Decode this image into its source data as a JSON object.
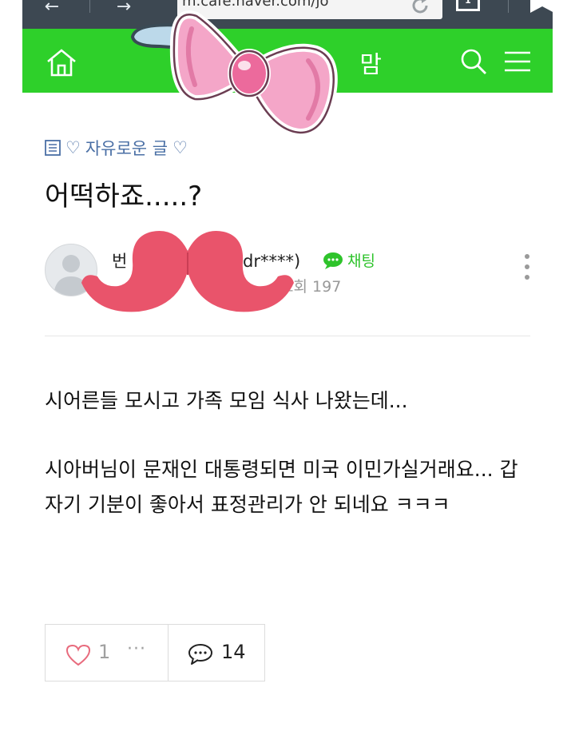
{
  "browser": {
    "url": "m.cafe.naver.com/jo",
    "tab_count": "1"
  },
  "header": {
    "title_visible": "맘"
  },
  "post": {
    "board": "자유로운 글",
    "board_heart_left": "♡",
    "board_heart_right": "♡",
    "title": "어떡하죠.....?",
    "author_visible": "번",
    "author_id_visible": "ndr****)",
    "chat_label": "채팅",
    "views_label": "조회 197",
    "body": [
      "시어른들 모시고 가족 모임 식사 나왔는데...",
      "시아버님이 문재인 대통령되면 미국 이민가실거래요... 갑자기 기분이 좋아서 표정관리가 안 되네요 ㅋㅋㅋ"
    ]
  },
  "actions": {
    "like_count": "1",
    "like_more": "···",
    "comment_count": "14"
  },
  "colors": {
    "header_green": "#2ed02a",
    "browser_bar": "#3d4852",
    "board_blue": "#4a6fa5",
    "chat_green": "#2ec32b",
    "sticker_pink": "#f4a6c8",
    "mustache_red": "#e9546b"
  },
  "icons": [
    "back-arrow-icon",
    "forward-arrow-icon",
    "reload-icon",
    "tabs-icon",
    "bookmark-icon",
    "home-icon",
    "search-icon",
    "menu-icon",
    "board-list-icon",
    "chat-bubble-icon",
    "more-vertical-icon",
    "heart-icon",
    "comment-icon"
  ],
  "stickers": [
    "pink-bow",
    "red-mustache"
  ]
}
